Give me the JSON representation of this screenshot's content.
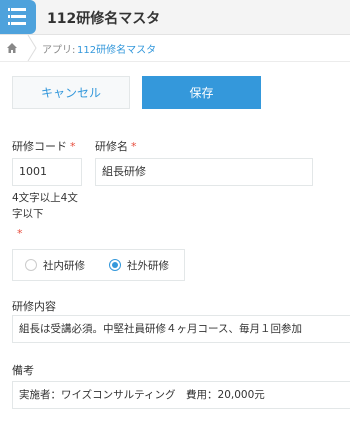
{
  "header": {
    "title": "112研修名マスタ"
  },
  "breadcrumb": {
    "prefix": "アプリ:",
    "app_link": "112研修名マスタ"
  },
  "actions": {
    "cancel_label": "キャンセル",
    "save_label": "保存"
  },
  "form": {
    "training_code": {
      "label": "研修コード",
      "required_mark": "*",
      "value": "1001",
      "hint": "4文字以上4文字以下"
    },
    "training_name": {
      "label": "研修名",
      "required_mark": "*",
      "value": "組長研修"
    },
    "training_type": {
      "required_mark": "*",
      "options": [
        "社内研修",
        "社外研修"
      ],
      "selected": "社外研修"
    },
    "training_content": {
      "label": "研修内容",
      "value": "組長は受講必須。中堅社員研修４ヶ月コース、毎月１回参加"
    },
    "remarks": {
      "label": "備考",
      "value": "実施者：ワイズコンサルティング　費用：20,000元"
    }
  },
  "colors": {
    "accent": "#3498db",
    "app_icon": "#4ea2dc",
    "required": "#e74c3c",
    "header_bg": "#f4f4f4"
  },
  "icons": {
    "app": "list-icon",
    "home": "home-icon",
    "separator": "chevron-right-icon"
  }
}
